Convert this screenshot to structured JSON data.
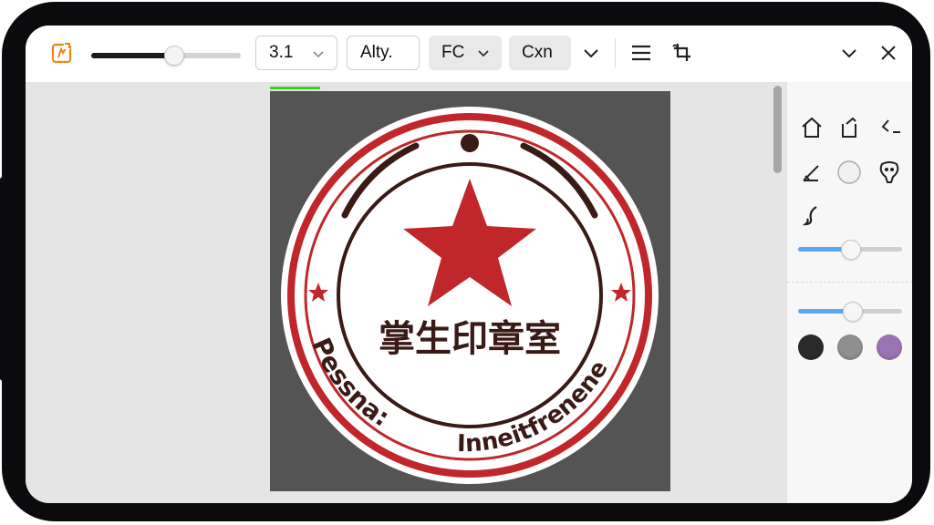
{
  "toolbar": {
    "zoom_slider": {
      "value": 0.55
    },
    "size_select": {
      "value": "3.1"
    },
    "font_field": {
      "value": "Alty."
    },
    "format_select": {
      "value": "FC"
    },
    "convert_button": {
      "label": "Cxn"
    }
  },
  "stamp": {
    "center_text": "掌生印章室",
    "bottom_left_text": "Pessna:",
    "bottom_right_text": "Inneitfrenene"
  },
  "colors": {
    "stamp_red": "#c0262a",
    "stamp_dark": "#3a1a16",
    "canvas_bg": "#545454",
    "accent_blue": "#5aa8f0",
    "progress_green": "#3bd11e"
  },
  "panel": {
    "tools": [
      "home-icon",
      "share-icon",
      "back-arrow-icon",
      "pen-icon",
      "circle-shape-icon",
      "mask-icon",
      "brush-icon"
    ],
    "slider1": {
      "value": 0.5
    },
    "slider2": {
      "value": 0.52
    },
    "swatches": [
      "#2a2a2a",
      "#8f8f8f",
      "#9b72b2"
    ]
  },
  "progress": {
    "value": 0.12
  }
}
